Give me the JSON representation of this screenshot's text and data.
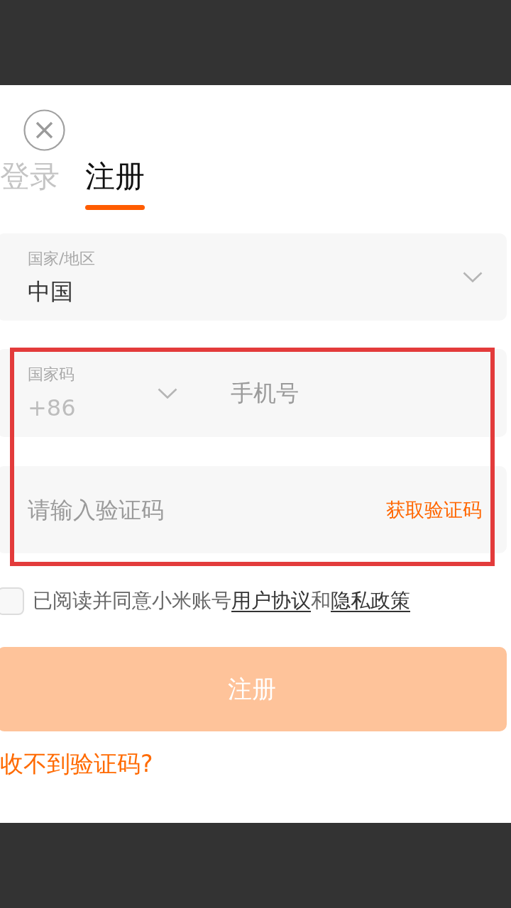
{
  "tabs": [
    {
      "label": "登录",
      "selected": false
    },
    {
      "label": "注册",
      "selected": true
    }
  ],
  "region_field": {
    "label": "国家/地区",
    "value": "中国"
  },
  "phone_row": {
    "country_code_label": "国家码",
    "country_code": "+86",
    "phone_placeholder": "手机号"
  },
  "code_field": {
    "placeholder": "请输入验证码",
    "action": "获取验证码"
  },
  "agreement": {
    "checked": false,
    "parts": [
      {
        "kind": "text",
        "text": "已阅读并同意小米账号"
      },
      {
        "kind": "link",
        "text": "用户协议"
      },
      {
        "kind": "text",
        "text": "和"
      },
      {
        "kind": "link",
        "text": "隐私政策"
      }
    ]
  },
  "submit_button": {
    "label": "注册",
    "disabled": true
  },
  "help_link": {
    "label": "收不到验证码?"
  }
}
